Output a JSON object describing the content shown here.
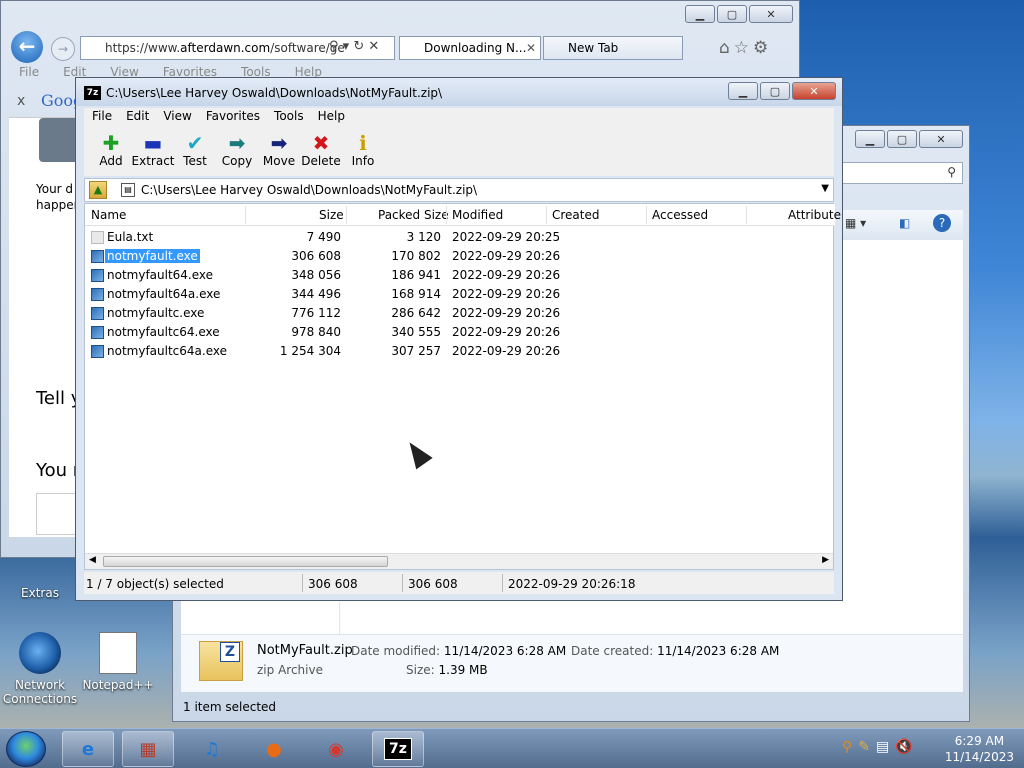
{
  "browser": {
    "url_prefix": "https://www.",
    "url_domain": "afterdawn.com",
    "url_rest": "/software/ge",
    "tabs": [
      "Downloading N...",
      "New Tab"
    ],
    "menu": [
      "File",
      "Edit",
      "View",
      "Favorites",
      "Tools",
      "Help"
    ],
    "toolbar_label": "Goog",
    "page_text": [
      "Your d",
      "happen",
      "Tell y",
      "You r"
    ]
  },
  "zip": {
    "title": "C:\\Users\\Lee Harvey Oswald\\Downloads\\NotMyFault.zip\\",
    "app_icon": "7z",
    "menu": [
      "File",
      "Edit",
      "View",
      "Favorites",
      "Tools",
      "Help"
    ],
    "tools": [
      {
        "label": "Add",
        "icon": "plus-icon",
        "glyph": "✚",
        "color": "#19a11f"
      },
      {
        "label": "Extract",
        "icon": "minus-icon",
        "glyph": "▬",
        "color": "#1c34b6"
      },
      {
        "label": "Test",
        "icon": "check-icon",
        "glyph": "✔",
        "color": "#1fa8c4"
      },
      {
        "label": "Copy",
        "icon": "copy-arrow-icon",
        "glyph": "➡",
        "color": "#1b7c7a"
      },
      {
        "label": "Move",
        "icon": "move-arrow-icon",
        "glyph": "➡",
        "color": "#15237a"
      },
      {
        "label": "Delete",
        "icon": "delete-x-icon",
        "glyph": "✖",
        "color": "#d3161b"
      },
      {
        "label": "Info",
        "icon": "info-icon",
        "glyph": "ℹ",
        "color": "#c9a000"
      }
    ],
    "path": "C:\\Users\\Lee Harvey Oswald\\Downloads\\NotMyFault.zip\\",
    "columns": [
      "Name",
      "Size",
      "Packed Size",
      "Modified",
      "Created",
      "Accessed",
      "Attribute"
    ],
    "rows": [
      {
        "name": "Eula.txt",
        "size": "7 490",
        "packed": "3 120",
        "modified": "2022-09-29 20:25",
        "type": "txt"
      },
      {
        "name": "notmyfault.exe",
        "size": "306 608",
        "packed": "170 802",
        "modified": "2022-09-29 20:26",
        "type": "exe"
      },
      {
        "name": "notmyfault64.exe",
        "size": "348 056",
        "packed": "186 941",
        "modified": "2022-09-29 20:26",
        "type": "exe"
      },
      {
        "name": "notmyfault64a.exe",
        "size": "344 496",
        "packed": "168 914",
        "modified": "2022-09-29 20:26",
        "type": "exe"
      },
      {
        "name": "notmyfaultc.exe",
        "size": "776 112",
        "packed": "286 642",
        "modified": "2022-09-29 20:26",
        "type": "exe"
      },
      {
        "name": "notmyfaultc64.exe",
        "size": "978 840",
        "packed": "340 555",
        "modified": "2022-09-29 20:26",
        "type": "exe"
      },
      {
        "name": "notmyfaultc64a.exe",
        "size": "1 254 304",
        "packed": "307 257",
        "modified": "2022-09-29 20:26",
        "type": "exe"
      }
    ],
    "status": {
      "selected": "1 / 7 object(s) selected",
      "size": "306 608",
      "packed": "306 608",
      "modified": "2022-09-29 20:26:18"
    }
  },
  "explorer": {
    "file_name": "NotMyFault.zip",
    "file_type": "zip Archive",
    "date_modified_label": "Date modified:",
    "date_modified": "11/14/2023 6:28 AM",
    "date_created_label": "Date created:",
    "date_created": "11/14/2023 6:28 AM",
    "size_label": "Size:",
    "size": "1.39 MB",
    "status": "1 item selected"
  },
  "desktop": {
    "icons": [
      "Extras",
      "Network Connections",
      "Notepad++"
    ]
  },
  "taskbar": {
    "time": "6:29 AM",
    "date": "11/14/2023",
    "zip_label": "7z"
  }
}
